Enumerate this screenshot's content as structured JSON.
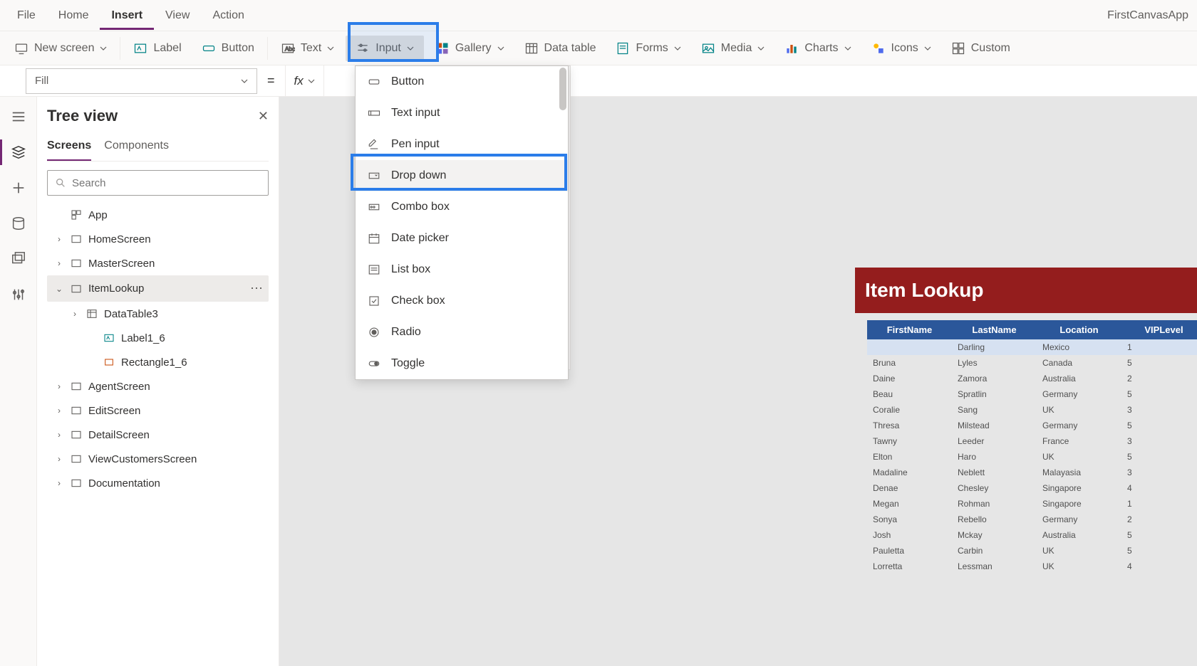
{
  "menu": {
    "items": [
      "File",
      "Home",
      "Insert",
      "View",
      "Action"
    ],
    "active": "Insert",
    "app_name": "FirstCanvasApp"
  },
  "ribbon": {
    "new_screen": "New screen",
    "label": "Label",
    "button": "Button",
    "text": "Text",
    "input": "Input",
    "gallery": "Gallery",
    "data_table": "Data table",
    "forms": "Forms",
    "media": "Media",
    "charts": "Charts",
    "icons": "Icons",
    "custom": "Custom"
  },
  "formula": {
    "property": "Fill",
    "fx": "fx"
  },
  "tree": {
    "title": "Tree view",
    "tabs": [
      "Screens",
      "Components"
    ],
    "search_placeholder": "Search",
    "app": "App",
    "items": [
      {
        "label": "HomeScreen"
      },
      {
        "label": "MasterScreen"
      },
      {
        "label": "ItemLookup",
        "selected": true,
        "expanded": true,
        "children": [
          {
            "label": "DataTable3",
            "type": "datatable"
          },
          {
            "label": "Label1_6",
            "type": "label"
          },
          {
            "label": "Rectangle1_6",
            "type": "rectangle"
          }
        ]
      },
      {
        "label": "AgentScreen"
      },
      {
        "label": "EditScreen"
      },
      {
        "label": "DetailScreen"
      },
      {
        "label": "ViewCustomersScreen"
      },
      {
        "label": "Documentation"
      }
    ]
  },
  "input_menu": {
    "items": [
      "Button",
      "Text input",
      "Pen input",
      "Drop down",
      "Combo box",
      "Date picker",
      "List box",
      "Check box",
      "Radio",
      "Toggle"
    ],
    "hovered": "Drop down"
  },
  "preview": {
    "title": "Item Lookup",
    "columns": [
      "FirstName",
      "LastName",
      "Location",
      "VIPLevel"
    ],
    "rows": [
      [
        "",
        "Darling",
        "Mexico",
        "1"
      ],
      [
        "Bruna",
        "Lyles",
        "Canada",
        "5"
      ],
      [
        "Daine",
        "Zamora",
        "Australia",
        "2"
      ],
      [
        "Beau",
        "Spratlin",
        "Germany",
        "5"
      ],
      [
        "Coralie",
        "Sang",
        "UK",
        "3"
      ],
      [
        "Thresa",
        "Milstead",
        "Germany",
        "5"
      ],
      [
        "Tawny",
        "Leeder",
        "France",
        "3"
      ],
      [
        "Elton",
        "Haro",
        "UK",
        "5"
      ],
      [
        "Madaline",
        "Neblett",
        "Malayasia",
        "3"
      ],
      [
        "Denae",
        "Chesley",
        "Singapore",
        "4"
      ],
      [
        "Megan",
        "Rohman",
        "Singapore",
        "1"
      ],
      [
        "Sonya",
        "Rebello",
        "Germany",
        "2"
      ],
      [
        "Josh",
        "Mckay",
        "Australia",
        "5"
      ],
      [
        "Pauletta",
        "Carbin",
        "UK",
        "5"
      ],
      [
        "Lorretta",
        "Lessman",
        "UK",
        "4"
      ]
    ]
  }
}
